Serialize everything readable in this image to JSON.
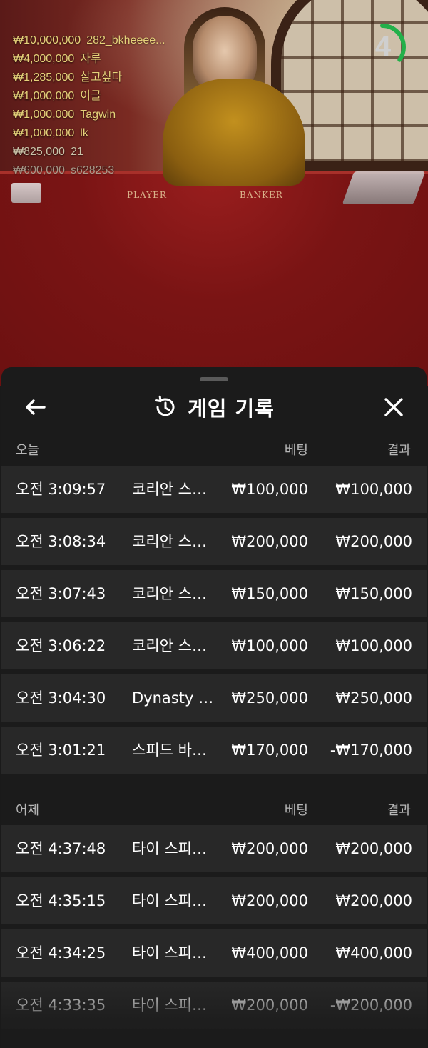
{
  "live": {
    "timer": "4",
    "timer_progress": 0.35,
    "felt_labels": {
      "player": "PLAYER",
      "banker": "BANKER"
    },
    "winners": [
      {
        "amount": "₩10,000,000",
        "name": "282_bkheeee..."
      },
      {
        "amount": "₩4,000,000",
        "name": "자루"
      },
      {
        "amount": "₩1,285,000",
        "name": "살고싶다"
      },
      {
        "amount": "₩1,000,000",
        "name": "이글"
      },
      {
        "amount": "₩1,000,000",
        "name": "Tagwin"
      },
      {
        "amount": "₩1,000,000",
        "name": "lk"
      },
      {
        "amount": "₩825,000",
        "name": "21"
      },
      {
        "amount": "₩600,000",
        "name": "s628253"
      }
    ]
  },
  "sheet": {
    "title": "게임 기록",
    "icons": {
      "back": "arrow-left-icon",
      "history": "history-icon",
      "close": "close-icon"
    },
    "sections": [
      {
        "label": "오늘",
        "bet_header": "베팅",
        "result_header": "결과",
        "rows": [
          {
            "time": "오전 3:09:57",
            "game": "코리안 스피드 바카라",
            "bet": "₩100,000",
            "result": "₩100,000"
          },
          {
            "time": "오전 3:08:34",
            "game": "코리안 스피드 바카라",
            "bet": "₩200,000",
            "result": "₩200,000"
          },
          {
            "time": "오전 3:07:43",
            "game": "코리안 스피드 바카라",
            "bet": "₩150,000",
            "result": "₩150,000"
          },
          {
            "time": "오전 3:06:22",
            "game": "코리안 스피드 바카라",
            "bet": "₩100,000",
            "result": "₩100,000"
          },
          {
            "time": "오전 3:04:30",
            "game": "Dynasty Speed Baccarat",
            "bet": "₩250,000",
            "result": "₩250,000"
          },
          {
            "time": "오전 3:01:21",
            "game": "스피드 바카라",
            "bet": "₩170,000",
            "result": "-₩170,000"
          }
        ]
      },
      {
        "label": "어제",
        "bet_header": "베팅",
        "result_header": "결과",
        "rows": [
          {
            "time": "오전 4:37:48",
            "game": "타이 스피드 바카라",
            "bet": "₩200,000",
            "result": "₩200,000"
          },
          {
            "time": "오전 4:35:15",
            "game": "타이 스피드 바카라",
            "bet": "₩200,000",
            "result": "₩200,000"
          },
          {
            "time": "오전 4:34:25",
            "game": "타이 스피드 바카라",
            "bet": "₩400,000",
            "result": "₩400,000"
          },
          {
            "time": "오전 4:33:35",
            "game": "타이 스피드 바카라",
            "bet": "₩200,000",
            "result": "-₩200,000"
          }
        ]
      }
    ]
  }
}
